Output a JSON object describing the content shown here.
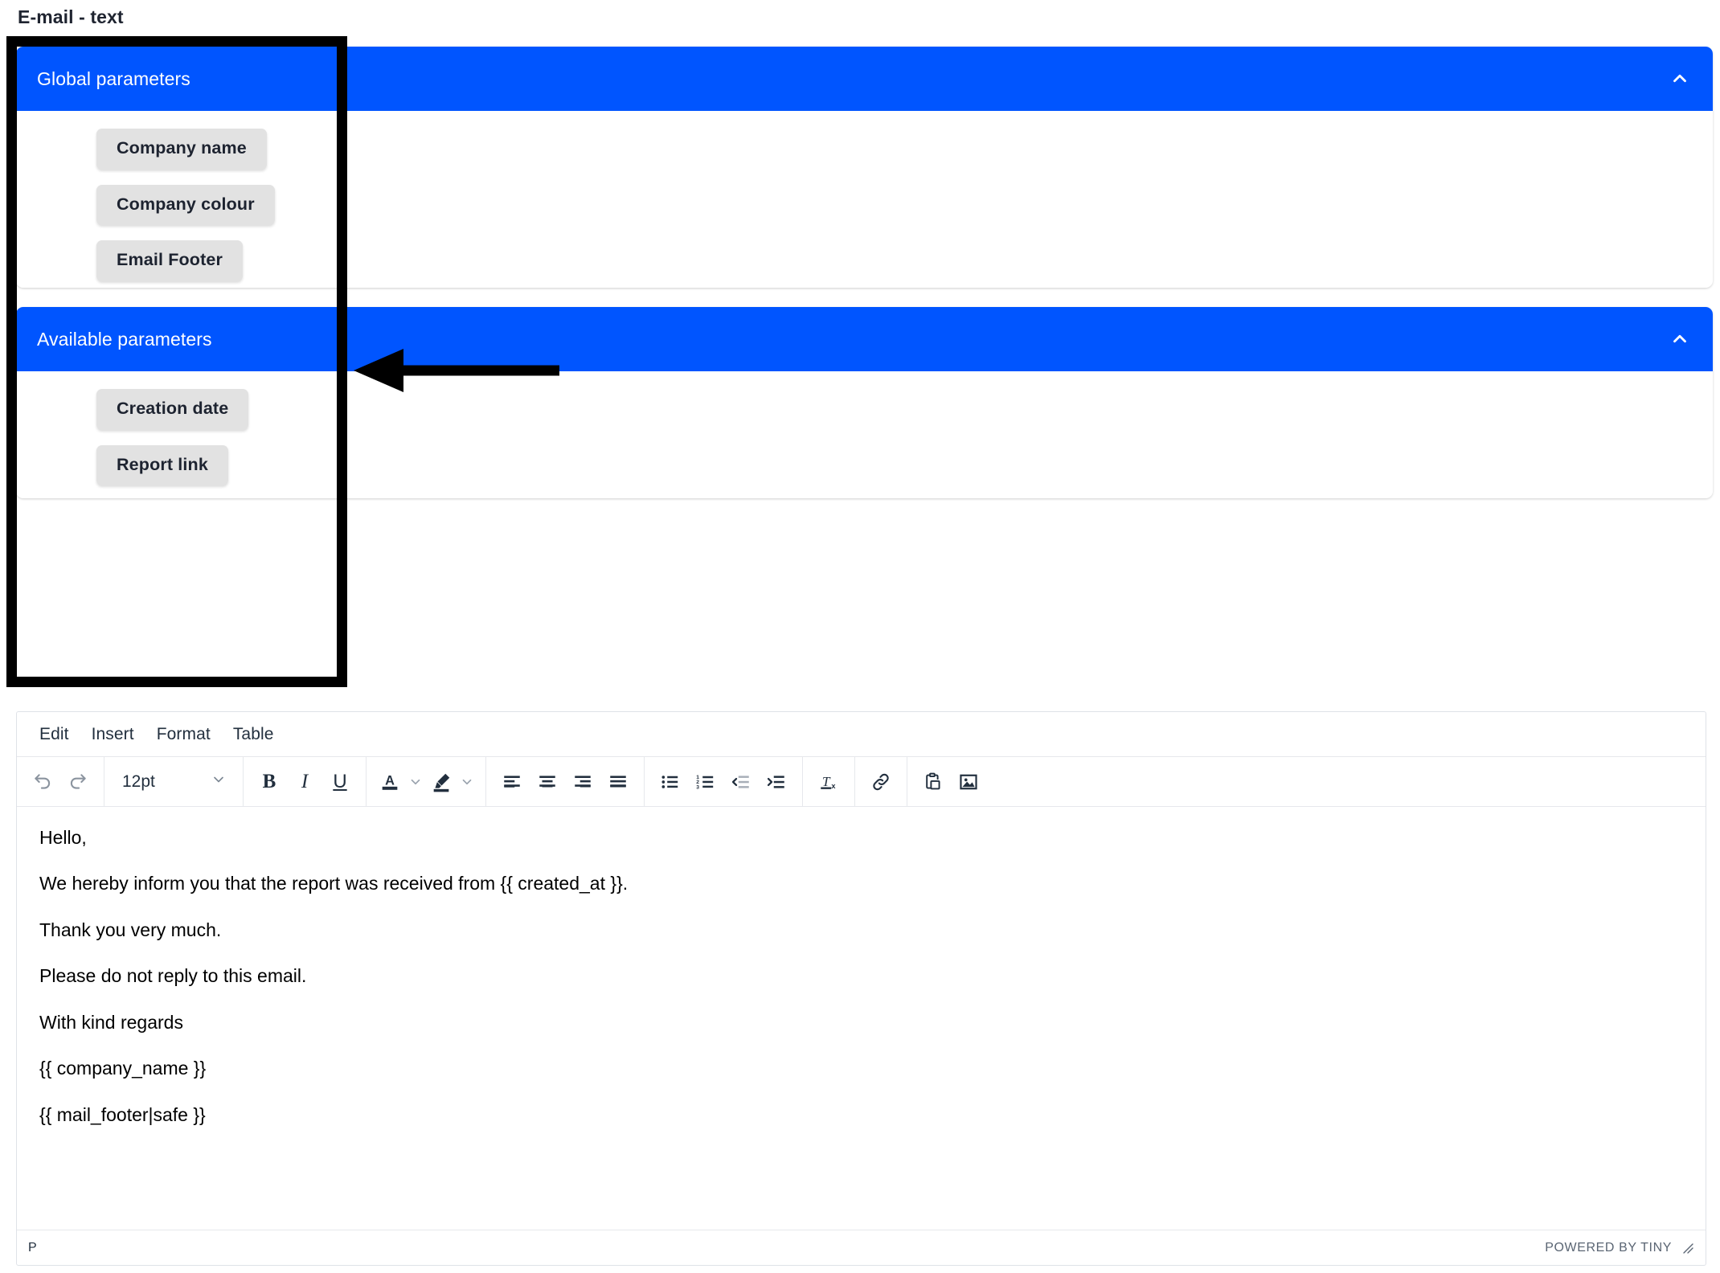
{
  "page": {
    "title": "E-mail - text"
  },
  "accordions": [
    {
      "id": "global-parameters",
      "header_label": "Global parameters",
      "expanded": true,
      "toggle_icon": "chevron-up-icon",
      "chips": [
        {
          "label": "Company name"
        },
        {
          "label": "Company colour"
        },
        {
          "label": "Email Footer"
        }
      ]
    },
    {
      "id": "available-parameters",
      "header_label": "Available parameters",
      "expanded": true,
      "toggle_icon": "chevron-up-icon",
      "chips": [
        {
          "label": "Creation date"
        },
        {
          "label": "Report link"
        }
      ]
    }
  ],
  "annotations": {
    "highlight_box": {
      "shape": "rectangle",
      "color": "#000000"
    },
    "pointer_arrow": {
      "shape": "arrow-left",
      "color": "#000000"
    }
  },
  "editor": {
    "menubar": [
      {
        "label": "Edit",
        "name": "menu-edit"
      },
      {
        "label": "Insert",
        "name": "menu-insert"
      },
      {
        "label": "Format",
        "name": "menu-format"
      },
      {
        "label": "Table",
        "name": "menu-table"
      }
    ],
    "toolbar": {
      "undo": "undo-icon",
      "redo": "redo-icon",
      "fontsize_value": "12pt",
      "fontsize_caret": "chevron-down-icon",
      "bold": "B",
      "italic": "I",
      "underline": "U",
      "forecolor": "A",
      "forecolor_caret": "chevron-down-icon",
      "backcolor": "highlight-marker-icon",
      "backcolor_caret": "chevron-down-icon",
      "align_left": "align-left-icon",
      "align_center": "align-center-icon",
      "align_right": "align-right-icon",
      "align_justify": "align-justify-icon",
      "bullist": "bullet-list-icon",
      "numlist": "numbered-list-icon",
      "outdent": "outdent-icon",
      "indent": "indent-icon",
      "removeformat": "remove-format-icon",
      "link": "link-icon",
      "paste": "paste-clipboard-icon",
      "image": "insert-image-icon"
    },
    "body_paragraphs": [
      "Hello,",
      "We hereby inform you that the report was received from {{ created_at }}.",
      "Thank you very much.",
      "Please do not reply to this email.",
      "With kind regards",
      "{{ company_name }}",
      "{{ mail_footer|safe }}"
    ],
    "statusbar": {
      "element_path": "P",
      "branding": "POWERED BY TINY",
      "resize_handle": "resize-grip-icon"
    }
  },
  "colors": {
    "accent_blue": "#0055FF",
    "chip_grey": "#e2e2e2",
    "annotation_black": "#000000",
    "text_dark": "#222f3e"
  }
}
